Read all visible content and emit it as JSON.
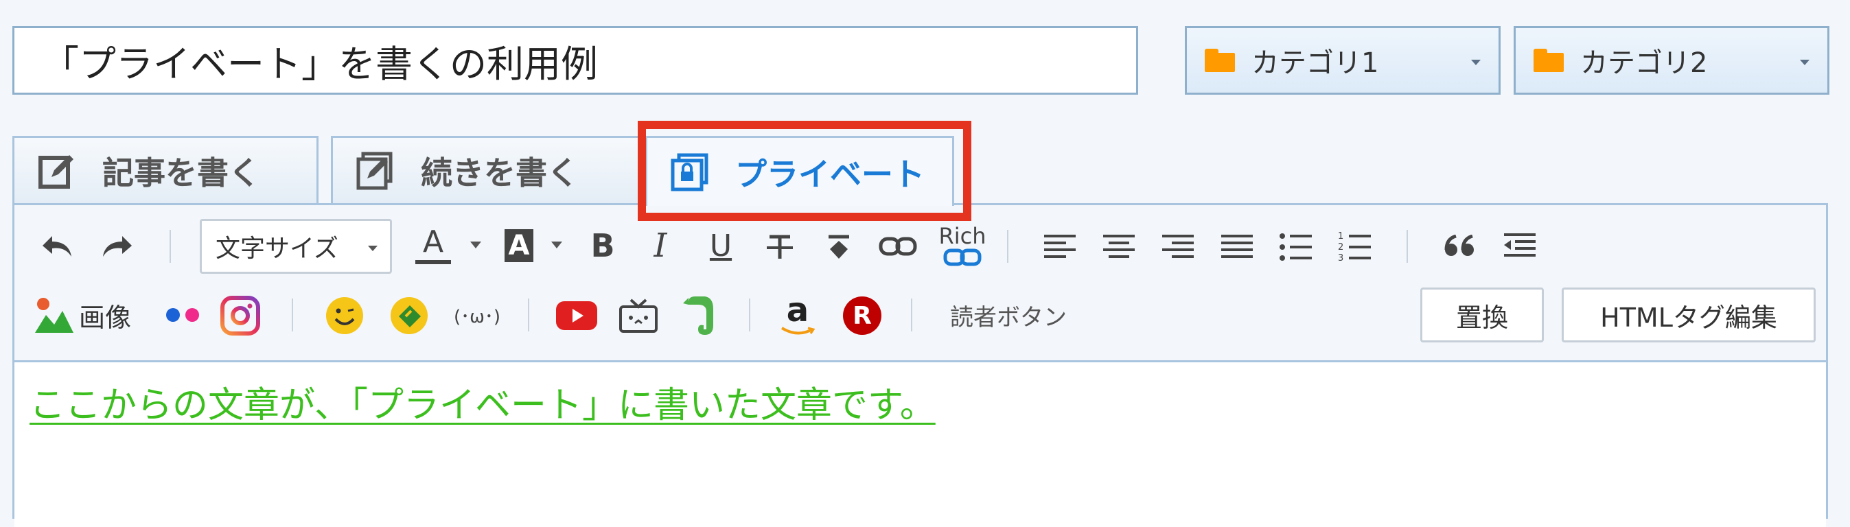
{
  "title_input": {
    "value": "「プライベート」を書くの利用例"
  },
  "categories": [
    {
      "label": "カテゴリ1",
      "icon": "folder-icon"
    },
    {
      "label": "カテゴリ2",
      "icon": "folder-icon"
    }
  ],
  "tabs": [
    {
      "label": "記事を書く",
      "icon": "edit-icon",
      "active": false
    },
    {
      "label": "続きを書く",
      "icon": "edit-continue-icon",
      "active": false
    },
    {
      "label": "プライベート",
      "icon": "private-icon",
      "active": true
    }
  ],
  "toolbar": {
    "font_size_label": "文字サイズ",
    "font_color_glyph": "A",
    "bg_color_glyph": "A",
    "bold": "B",
    "italic": "I",
    "underline": "U",
    "rich_link_label": "Rich",
    "image_label": "画像",
    "emoticon_label": "(･ω･)",
    "amazon_glyph": "a",
    "rakuten_glyph": "R",
    "reader_button_label": "読者ボタン",
    "replace_button": "置換",
    "html_edit_button": "HTMLタグ編集"
  },
  "editor": {
    "text": "ここからの文章が、「プライベート」に書いた文章です。"
  },
  "colors": {
    "accent": "#1a7bd6",
    "highlight": "#e43420",
    "editor_text": "#3cbf1e",
    "folder": "#ff9a00"
  }
}
